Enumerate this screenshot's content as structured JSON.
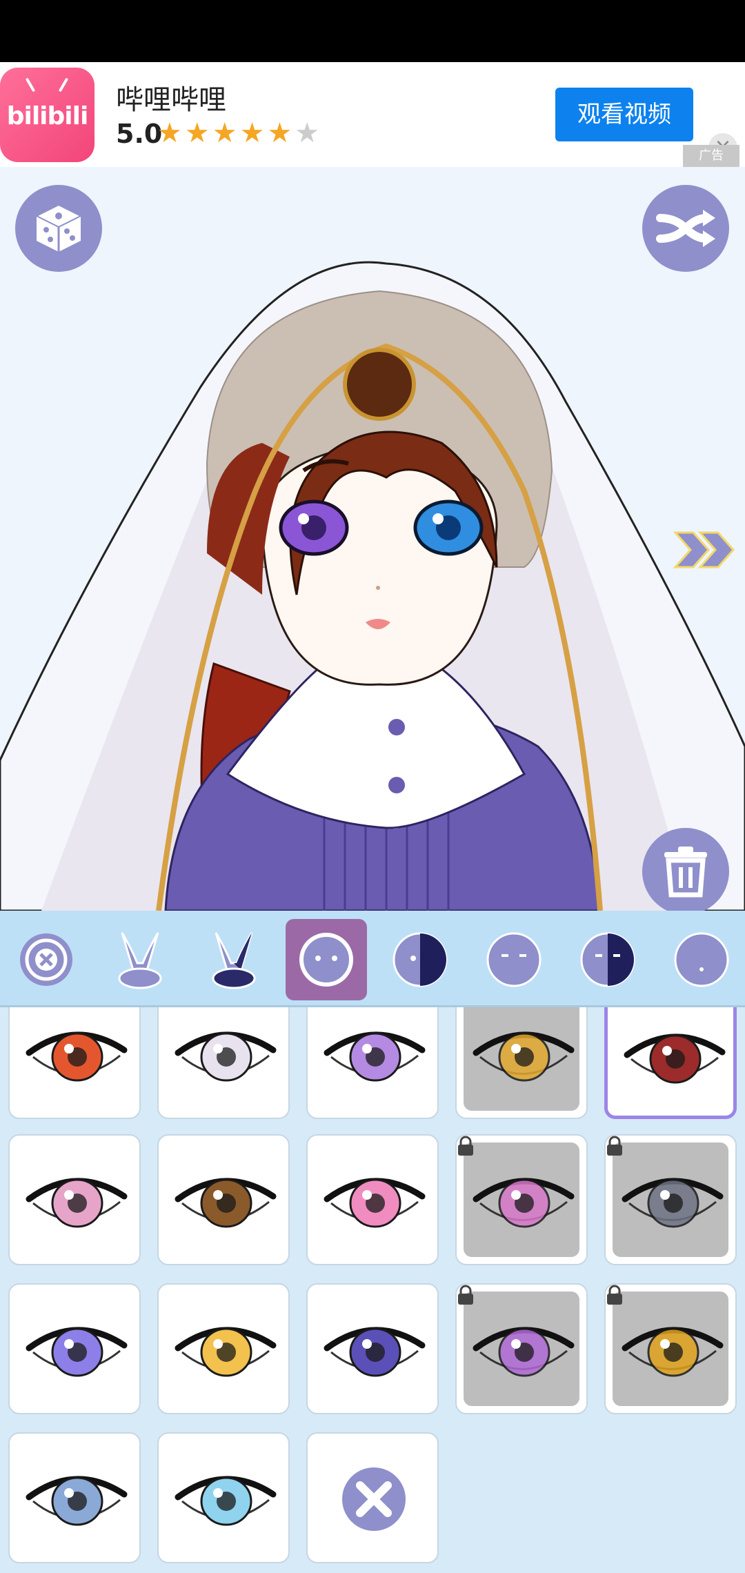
{
  "ad": {
    "app_name": "哔哩哔哩",
    "rating": "5.0",
    "stars_filled": 5,
    "stars_total": 6,
    "cta_label": "观看视频",
    "close_glyph": "×",
    "ad_tag": "广告",
    "logo_text": "bilibili"
  },
  "preview": {
    "dice_icon": "dice-icon",
    "shuffle_icon": "shuffle-icon",
    "next_icon": "double-chevron-right-icon",
    "trash_icon": "trash-icon"
  },
  "tabs": [
    {
      "name": "none-tab",
      "icon": "eye-off-icon"
    },
    {
      "name": "bunny-ears-tab",
      "icon": "bunny-ears-icon"
    },
    {
      "name": "bunny-ears-dark-tab",
      "icon": "bunny-ears-dark-icon"
    },
    {
      "name": "eyes-tab",
      "icon": "eyes-icon",
      "selected": true
    },
    {
      "name": "half-eyes-tab",
      "icon": "half-face-icon"
    },
    {
      "name": "eyebrows-tab",
      "icon": "eyebrows-icon"
    },
    {
      "name": "half-brow-tab",
      "icon": "half-brow-icon"
    },
    {
      "name": "mouth-tab",
      "icon": "mouth-icon"
    }
  ],
  "eye_items": [
    {
      "iris": "#e4572e",
      "locked": false
    },
    {
      "iris": "#e8e2ee",
      "locked": false
    },
    {
      "iris": "#b58ae3",
      "locked": false
    },
    {
      "iris": "#e3a82f",
      "locked": true,
      "video": true
    },
    {
      "iris": "#9c2b2b",
      "locked": false,
      "selected": true
    },
    {
      "iris": "#e7a4c9",
      "locked": false
    },
    {
      "iris": "#8b5a2b",
      "locked": false
    },
    {
      "iris": "#f08cc0",
      "locked": false
    },
    {
      "iris": "#d677c9",
      "locked": true
    },
    {
      "iris": "#6e7384",
      "locked": true
    },
    {
      "iris": "#8d7fe8",
      "locked": false
    },
    {
      "iris": "#f2c14e",
      "locked": false
    },
    {
      "iris": "#5b50b8",
      "locked": false
    },
    {
      "iris": "#b069d6",
      "locked": true
    },
    {
      "iris": "#e0a11b",
      "locked": true
    },
    {
      "iris": "#8aa9d6",
      "locked": false
    },
    {
      "iris": "#8fd3ef",
      "locked": false
    },
    {
      "iris": "none",
      "locked": false,
      "clear": true
    }
  ],
  "colors": {
    "accent": "#8f8fcb",
    "tab_bg": "#bde0f7",
    "tab_selected": "#9b6aa6",
    "grid_bg": "#d6eaf8",
    "ad_button": "#0d82ee"
  }
}
